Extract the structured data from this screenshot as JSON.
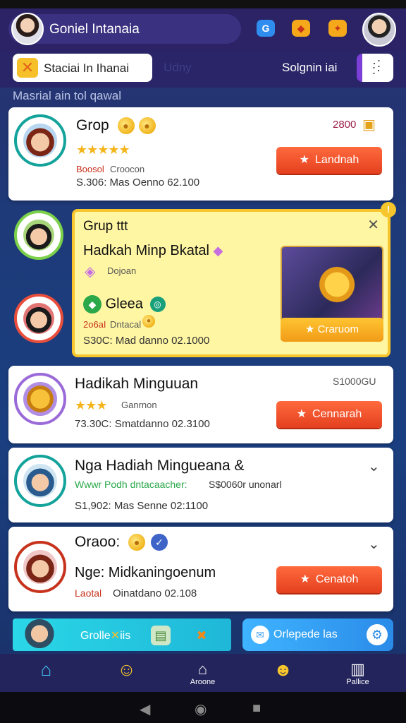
{
  "header": {
    "profile_name": "Goniel Intanaia",
    "top_icons": [
      "G",
      "◆",
      "✦"
    ]
  },
  "tabs": {
    "active": "Staciai In Ihanai",
    "ghost": "Udny",
    "right": "Solgnin iai"
  },
  "section_label": "Masrial ain tol qawal",
  "cards": [
    {
      "title": "Grop",
      "count": "2800",
      "subline_red": "Boosol",
      "subline_grey": "Croocon",
      "meta": "S.306: Mas Oenno 62.100",
      "action": "Landnah"
    },
    {
      "title": "Hadikah Minguuan",
      "count": "S1000GU",
      "subline_grey": "Ganrnon",
      "meta": "73.30C: Smatdanno 02.3100",
      "action": "Cennarah"
    },
    {
      "title": "Nga Hadiah Mingueana",
      "suffix": "&",
      "subline_green": "Wwwr Podh dntacaacher:",
      "subline_grey": "S$0060r unonarl",
      "meta": "S1,902: Mas Senne 02:1100"
    },
    {
      "title": "Oraoo:",
      "subtitle": "Nge: Midkaningoenum",
      "subline_red": "Laotal",
      "subline_grey": "Oinatdano 02.108",
      "action": "Cenatoh"
    }
  ],
  "featured": {
    "group": "Grup",
    "group_suffix": "ttt",
    "title": "Hadkah Minp Bkatal",
    "subtitle": "Dojoan",
    "name": "Gleea",
    "subline_red": "2o6aI",
    "subline_grey": "Dntacal",
    "meta": "S30C: Mad danno 02.1000",
    "button": "Craruom"
  },
  "bottom_strip": {
    "left_label": "Grolle",
    "left_suffix": "iis",
    "right_label": "Orlepede las"
  },
  "navbar": [
    {
      "label": "",
      "icon": "home-icon"
    },
    {
      "label": "",
      "icon": "emoji-icon"
    },
    {
      "label": "Aroone",
      "icon": "house-outline-icon"
    },
    {
      "label": "",
      "icon": "faces-icon"
    },
    {
      "label": "Pallice",
      "icon": "book-icon"
    }
  ],
  "colors": {
    "accent_orange": "#e4401f",
    "featured_yellow": "#f7c52c",
    "teal": "#13a39a",
    "nav_bg": "#24245c"
  }
}
